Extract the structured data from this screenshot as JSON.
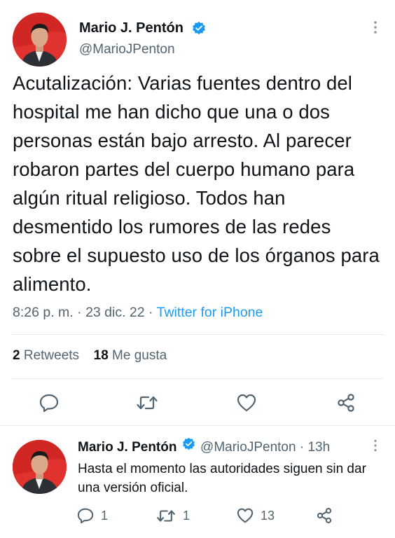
{
  "colors": {
    "accent": "#1d9bf0",
    "text": "#0f1419",
    "muted": "#536471",
    "avatar_bg": "#e0322e"
  },
  "main_tweet": {
    "author_name": "Mario J. Pentón",
    "handle": "@MarioJPenton",
    "text": "Acutalización: Varias fuentes dentro del hospital me han dicho que una o dos personas están bajo arresto. Al parecer robaron partes del cuerpo humano para algún ritual religioso. Todos han desmentido los rumores de las redes sobre el supuesto uso de los órganos para alimento.",
    "time": "8:26 p. m.",
    "date": "23 dic. 22",
    "separator": "·",
    "source": "Twitter for iPhone",
    "retweets_count": "2",
    "retweets_label": "Retweets",
    "likes_count": "18",
    "likes_label": "Me gusta",
    "actions": [
      "reply-icon",
      "retweet-icon",
      "like-icon",
      "share-icon"
    ]
  },
  "reply_tweet": {
    "author_name": "Mario J. Pentón",
    "handle": "@MarioJPenton",
    "separator": "·",
    "age": "13h",
    "text": "Hasta el momento las autoridades siguen sin dar una versión oficial.",
    "reply_count": "1",
    "retweet_count": "1",
    "like_count": "13"
  }
}
